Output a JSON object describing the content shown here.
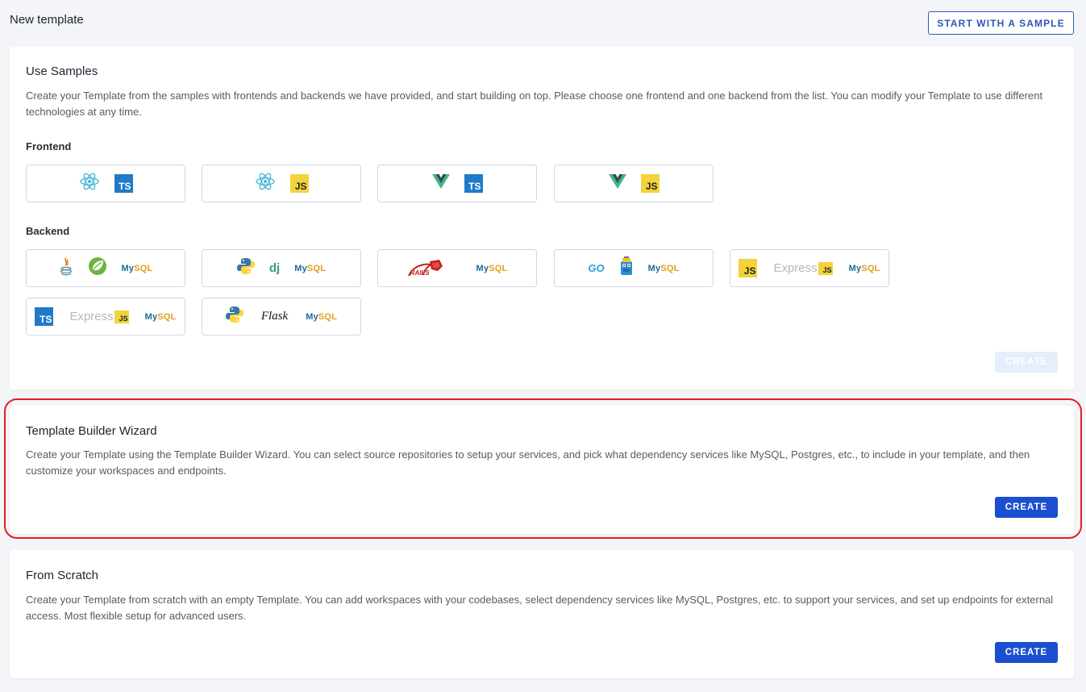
{
  "page": {
    "title": "New template",
    "start_sample_label": "START WITH A SAMPLE"
  },
  "samples": {
    "title": "Use Samples",
    "description": "Create your Template from the samples with frontends and backends we have provided, and start building on top. Please choose one frontend and one backend from the list. You can modify your Template to use different technologies at any time.",
    "frontend_label": "Frontend",
    "backend_label": "Backend",
    "create_label": "CREATE",
    "frontend": [
      {
        "icons": [
          "react-icon",
          "typescript-icon"
        ]
      },
      {
        "icons": [
          "react-icon",
          "javascript-icon"
        ]
      },
      {
        "icons": [
          "vue-icon",
          "typescript-icon"
        ]
      },
      {
        "icons": [
          "vue-icon",
          "javascript-icon"
        ]
      }
    ],
    "backend": [
      {
        "icons": [
          "java-icon",
          "spring-icon",
          "mysql-icon"
        ]
      },
      {
        "icons": [
          "python-icon",
          "django-icon",
          "mysql-icon"
        ]
      },
      {
        "icons": [
          "rails-icon",
          "mysql-icon"
        ]
      },
      {
        "icons": [
          "go-icon",
          "gopher-icon",
          "mysql-icon"
        ]
      },
      {
        "icons": [
          "javascript-icon",
          "express-icon",
          "mysql-icon"
        ]
      },
      {
        "icons": [
          "typescript-icon",
          "express-icon",
          "mysql-icon"
        ]
      },
      {
        "icons": [
          "python-icon",
          "flask-icon",
          "mysql-icon"
        ]
      }
    ],
    "logo_text": {
      "ts": "TS",
      "js": "JS",
      "my": "My",
      "sql": "SQL",
      "dj": "dj",
      "go": "GO",
      "express": "Express",
      "flask": "Flask",
      "rails": "RAILS"
    }
  },
  "wizard": {
    "title": "Template Builder Wizard",
    "description": "Create your Template using the Template Builder Wizard. You can select source repositories to setup your services, and pick what dependency services like MySQL, Postgres, etc., to include in your template, and then customize your workspaces and endpoints.",
    "create_label": "CREATE"
  },
  "scratch": {
    "title": "From Scratch",
    "description": "Create your Template from scratch with an empty Template. You can add workspaces with your codebases, select dependency services like MySQL, Postgres, etc. to support your services, and set up endpoints for external access. Most flexible setup for advanced users.",
    "create_label": "CREATE"
  },
  "colors": {
    "primary": "#1a4fcf",
    "highlight": "#e11f26",
    "background": "#f4f5f9"
  }
}
